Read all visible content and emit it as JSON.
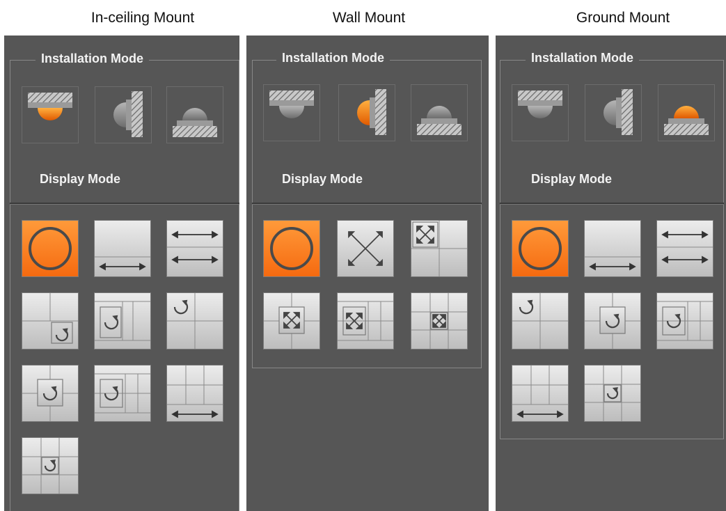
{
  "columns": [
    {
      "title": "In-ceiling Mount",
      "installation_label": "Installation Mode",
      "display_label": "Display Mode",
      "installation_icons": [
        "ceiling-mount-icon",
        "wall-mount-icon",
        "ground-mount-icon"
      ],
      "installation_selected": 0,
      "display_icons": [
        "fisheye-original-icon",
        "panorama-180-icon",
        "dual-panorama-icon",
        "one-plus-one-ptz-icon",
        "one-plus-three-ptz-icon",
        "one-plus-three-quad-icon",
        "one-plus-three-center-ptz-icon",
        "one-plus-six-ptz-icon",
        "panorama-plus-six-icon",
        "one-plus-eight-ptz-icon"
      ]
    },
    {
      "title": "Wall Mount",
      "installation_label": "Installation Mode",
      "display_label": "Display Mode",
      "installation_icons": [
        "ceiling-mount-icon",
        "wall-mount-icon",
        "ground-mount-icon"
      ],
      "installation_selected": 1,
      "display_icons": [
        "fisheye-original-icon",
        "panorama-stretch-icon",
        "one-plus-three-expand-icon",
        "one-plus-three-center-expand-icon",
        "one-plus-six-expand-icon",
        "one-plus-eight-expand-icon"
      ]
    },
    {
      "title": "Ground Mount",
      "installation_label": "Installation Mode",
      "display_label": "Display Mode",
      "installation_icons": [
        "ceiling-mount-icon",
        "wall-mount-icon",
        "ground-mount-icon"
      ],
      "installation_selected": 2,
      "display_icons": [
        "fisheye-original-icon",
        "panorama-180-icon",
        "dual-panorama-icon",
        "one-plus-three-quad-icon",
        "one-plus-three-center-ptz-icon",
        "one-plus-six-ptz-icon",
        "panorama-plus-six-icon",
        "one-plus-eight-ptz-icon"
      ]
    }
  ],
  "colors": {
    "panel_bg": "#565656",
    "selected_orange": "#ff7a1a",
    "button_gray": "#d4d4d4"
  }
}
